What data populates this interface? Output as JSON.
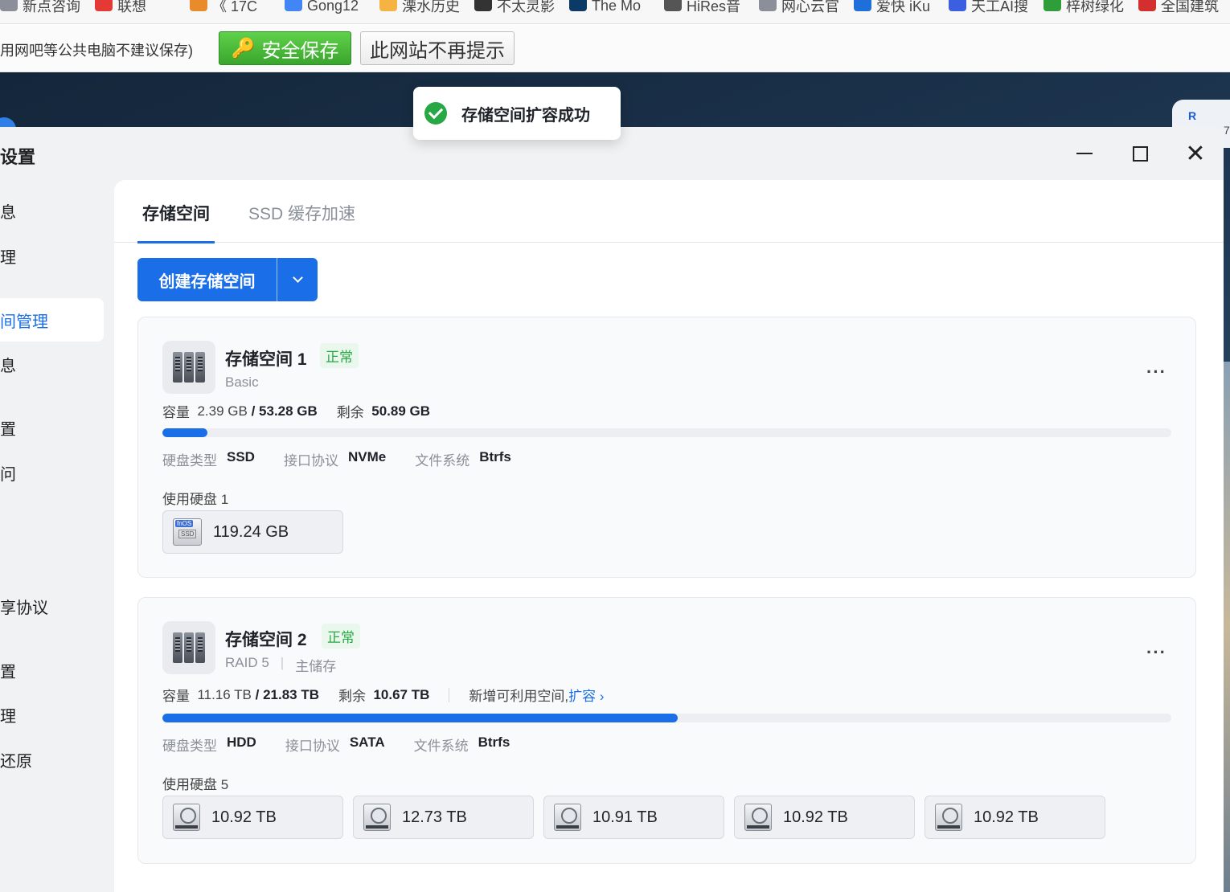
{
  "bookmarks": [
    {
      "label": "新点咨询",
      "color": "#8a8f99"
    },
    {
      "label": "联想",
      "color": "#e53935"
    },
    {
      "label": "《 17C",
      "color": "#e98b2a"
    },
    {
      "label": "Gong12",
      "color": "#4285f4"
    },
    {
      "label": "溧水历史",
      "color": "#f5b342"
    },
    {
      "label": "不太灵影",
      "color": "#333333"
    },
    {
      "label": "The Mo",
      "color": "#0b3a66"
    },
    {
      "label": "HiRes音",
      "color": "#555555"
    },
    {
      "label": "网心云官",
      "color": "#8a8f99"
    },
    {
      "label": "爱快 iKu",
      "color": "#1e6fd9"
    },
    {
      "label": "天工AI搜",
      "color": "#3b5fe0"
    },
    {
      "label": "梓树绿化",
      "color": "#2e9d3a"
    },
    {
      "label": "全国建筑",
      "color": "#d32f2f"
    }
  ],
  "savebar": {
    "message": "用网吧等公共电脑不建议保存)",
    "save_label": "安全保存",
    "nomore_label": "此网站不再提示"
  },
  "desktop_card": {
    "letter": "R",
    "num": "7"
  },
  "toast": {
    "text": "存储空间扩容成功"
  },
  "window": {
    "title": "设置",
    "sidebar": [
      "息",
      "理",
      "间管理",
      "息",
      "置",
      "问",
      "享协议",
      "置",
      "理",
      "还原"
    ],
    "active_index": 2
  },
  "tabs": {
    "storage": "存储空间",
    "ssd": "SSD 缓存加速"
  },
  "create_button": "创建存储空间",
  "labels": {
    "capacity": "容量",
    "remaining": "剩余",
    "disk_type": "硬盘类型",
    "interface": "接口协议",
    "filesystem": "文件系统",
    "used_disks": "使用硬盘",
    "status_normal": "正常",
    "more": "···",
    "expand_hint": "新增可利用空间,",
    "expand_link": "扩容 ›"
  },
  "pools": [
    {
      "name": "存储空间 1",
      "raid": "Basic",
      "role": "",
      "used": "2.39 GB",
      "total": "53.28 GB",
      "free": "50.89 GB",
      "usage_fraction": 0.045,
      "disk_type": "SSD",
      "interface": "NVMe",
      "filesystem": "Btrfs",
      "disk_count": "1",
      "disks": [
        "119.24 GB"
      ],
      "disk_icon_tag": "fnOS",
      "disk_icon_label": "SSD"
    },
    {
      "name": "存储空间 2",
      "raid": "RAID 5",
      "role": "主储存",
      "used": "11.16 TB",
      "total": "21.83 TB",
      "free": "10.67 TB",
      "usage_fraction": 0.511,
      "disk_type": "HDD",
      "interface": "SATA",
      "filesystem": "Btrfs",
      "disk_count": "5",
      "disks": [
        "10.92 TB",
        "12.73 TB",
        "10.91 TB",
        "10.92 TB",
        "10.92 TB"
      ]
    }
  ],
  "colors": {
    "accent": "#1a6ee8",
    "success": "#27a844",
    "safe_button": "#3aa52c"
  }
}
